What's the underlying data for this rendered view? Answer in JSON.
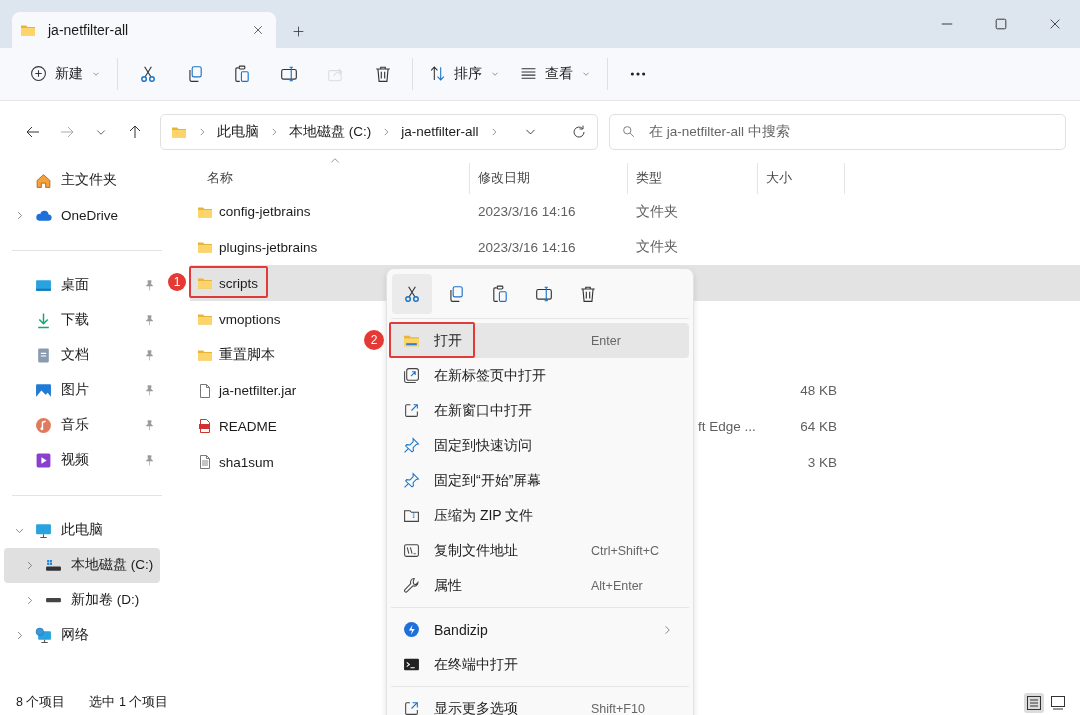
{
  "window": {
    "tab_title": "ja-netfilter-all"
  },
  "toolbar": [
    [
      {
        "kind": "new",
        "label": "新建",
        "disabled": false
      }
    ],
    [
      {
        "kind": "cut",
        "disabled": false
      },
      {
        "kind": "copy",
        "disabled": false
      },
      {
        "kind": "paste",
        "disabled": false
      },
      {
        "kind": "rename",
        "disabled": false
      },
      {
        "kind": "share",
        "disabled": true
      },
      {
        "kind": "delete",
        "disabled": false
      }
    ],
    [
      {
        "kind": "sort",
        "label": "排序",
        "disabled": false
      },
      {
        "kind": "view",
        "label": "查看",
        "disabled": false
      }
    ],
    [
      {
        "kind": "more",
        "disabled": false
      }
    ]
  ],
  "navigation": [
    {
      "kind": "back",
      "disabled": false
    },
    {
      "kind": "forward",
      "disabled": true
    },
    {
      "kind": "recent",
      "disabled": false
    },
    {
      "kind": "up",
      "disabled": false
    }
  ],
  "address_bar": {
    "crumbs": [
      "此电脑",
      "本地磁盘 (C:)",
      "ja-netfilter-all"
    ]
  },
  "search": {
    "placeholder": "在 ja-netfilter-all 中搜索"
  },
  "sidebar": {
    "sections": [
      {
        "items": [
          {
            "kind": "home",
            "label": "主文件夹",
            "selected": false
          },
          {
            "kind": "cloud",
            "label": "OneDrive",
            "expanded": false,
            "selected": false
          }
        ]
      },
      {
        "items": [
          {
            "kind": "desktop",
            "label": "桌面",
            "pinned": true,
            "selected": false
          },
          {
            "kind": "download",
            "label": "下载",
            "pinned": true,
            "selected": false
          },
          {
            "kind": "document",
            "label": "文档",
            "pinned": true,
            "selected": false
          },
          {
            "kind": "pictures",
            "label": "图片",
            "pinned": true,
            "selected": false
          },
          {
            "kind": "music",
            "label": "音乐",
            "pinned": true,
            "selected": false
          },
          {
            "kind": "video",
            "label": "视频",
            "pinned": true,
            "selected": false
          }
        ]
      },
      {
        "items": [
          {
            "kind": "pc",
            "label": "此电脑",
            "expanded": true,
            "selected": false,
            "children": [
              {
                "kind": "system-drive",
                "label": "本地磁盘 (C:)",
                "expanded": false,
                "selected": true
              },
              {
                "kind": "drive",
                "label": "新加卷 (D:)",
                "expanded": false,
                "selected": false
              }
            ]
          },
          {
            "kind": "network",
            "label": "网络",
            "expanded": false,
            "selected": false
          }
        ]
      }
    ]
  },
  "file_list": {
    "columns": [
      {
        "label": "名称",
        "sorted": true
      },
      {
        "label": "修改日期"
      },
      {
        "label": "类型"
      },
      {
        "label": "大小"
      }
    ],
    "rows": [
      {
        "kind": "folder",
        "name": "config-jetbrains",
        "date": "2023/3/16 14:16",
        "type": "文件夹",
        "selected": false
      },
      {
        "kind": "folder",
        "name": "plugins-jetbrains",
        "date": "2023/3/16 14:16",
        "type": "文件夹",
        "selected": false
      },
      {
        "kind": "folder",
        "name": "scripts",
        "selected": true,
        "annotation": "1"
      },
      {
        "kind": "folder",
        "name": "vmoptions",
        "selected": false
      },
      {
        "kind": "folder",
        "name": "重置脚本",
        "selected": false
      },
      {
        "kind": "file",
        "name": "ja-netfilter.jar",
        "size": "48 KB",
        "selected": false
      },
      {
        "kind": "pdf",
        "name": "README",
        "type": "ft Edge ...",
        "type_partly_covered": true,
        "size": "64 KB",
        "selected": false
      },
      {
        "kind": "text",
        "name": "sha1sum",
        "size": "3 KB",
        "selected": false
      }
    ]
  },
  "context_menu": {
    "quick_actions": [
      {
        "kind": "cut",
        "highlighted": true
      },
      {
        "kind": "copy",
        "highlighted": false
      },
      {
        "kind": "paste",
        "highlighted": false
      },
      {
        "kind": "rename",
        "highlighted": false
      },
      {
        "kind": "delete",
        "highlighted": false
      }
    ],
    "groups": [
      [
        {
          "kind": "open",
          "label": "打开",
          "shortcut": "Enter",
          "highlighted": true,
          "annotation": "2"
        },
        {
          "kind": "new-tab",
          "label": "在新标签页中打开",
          "highlighted": false
        },
        {
          "kind": "new-window",
          "label": "在新窗口中打开",
          "highlighted": false
        },
        {
          "kind": "pin",
          "label": "固定到快速访问",
          "highlighted": false
        },
        {
          "kind": "pin",
          "label": "固定到“开始”屏幕",
          "highlighted": false
        },
        {
          "kind": "zip",
          "label": "压缩为 ZIP 文件",
          "highlighted": false
        },
        {
          "kind": "copy-path",
          "label": "复制文件地址",
          "shortcut": "Ctrl+Shift+C",
          "highlighted": false
        },
        {
          "kind": "properties",
          "label": "属性",
          "shortcut": "Alt+Enter",
          "highlighted": false
        }
      ],
      [
        {
          "kind": "bandizip",
          "label": "Bandizip",
          "submenu": true,
          "highlighted": false
        },
        {
          "kind": "terminal",
          "label": "在终端中打开",
          "highlighted": false
        }
      ],
      [
        {
          "kind": "more-options",
          "label": "显示更多选项",
          "shortcut": "Shift+F10",
          "highlighted": false
        }
      ]
    ]
  },
  "status_bar": {
    "item_count": "8 个项目",
    "selection": "选中 1 个项目",
    "views": [
      {
        "kind": "details",
        "selected": true
      },
      {
        "kind": "tiles",
        "selected": false
      }
    ]
  }
}
